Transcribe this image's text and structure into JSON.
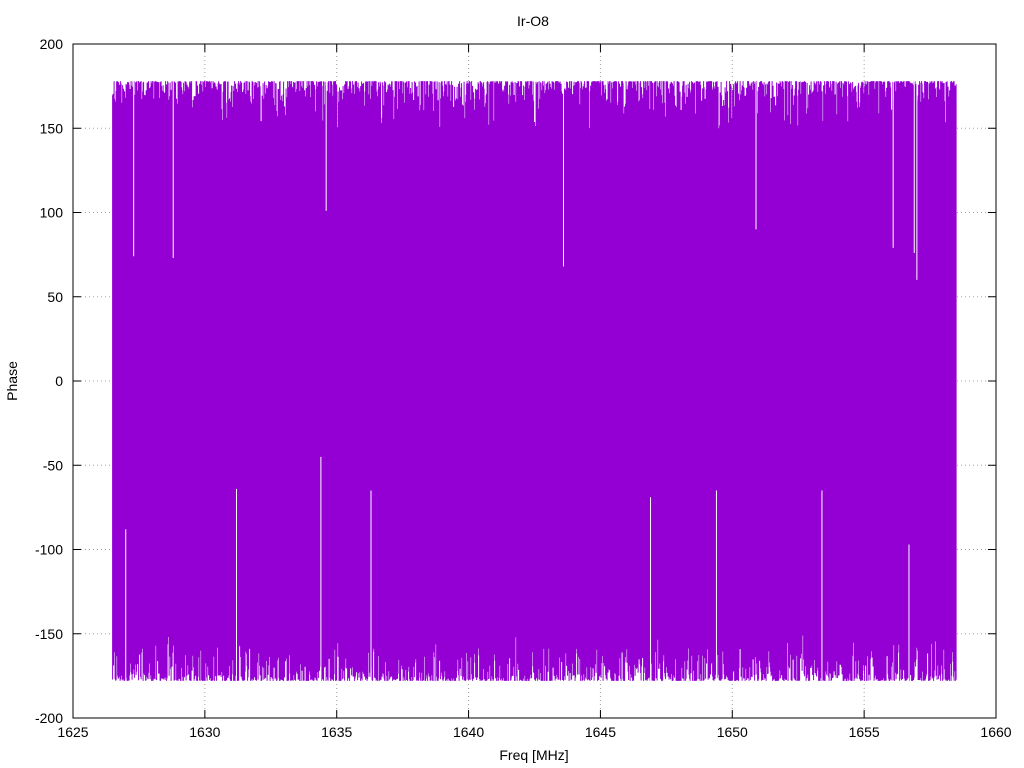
{
  "chart_data": {
    "type": "line",
    "title": "Ir-O8",
    "xlabel": "Freq [MHz]",
    "ylabel": "Phase",
    "xlim": [
      1625,
      1660
    ],
    "ylim": [
      -200,
      200
    ],
    "xticks": [
      "1625",
      "1630",
      "1635",
      "1640",
      "1645",
      "1650",
      "1655",
      "1660"
    ],
    "yticks": [
      "200",
      "150",
      "100",
      "50",
      "0",
      "-50",
      "-100",
      "-150",
      "-200"
    ],
    "grid": true,
    "series_color": "#9400d3",
    "series": [
      {
        "x_range": [
          1626.5,
          1658.5
        ],
        "envelope_upper": 178,
        "envelope_lower": -178,
        "description_values": "phase wraps rapidly between about -180 and 180 across the whole band",
        "notable_upper_dips": [
          [
            1627.3,
            74
          ],
          [
            1628.8,
            73
          ],
          [
            1634.6,
            101
          ],
          [
            1643.6,
            68
          ],
          [
            1650.9,
            90
          ],
          [
            1656.1,
            79
          ],
          [
            1656.9,
            76
          ],
          [
            1657.0,
            60
          ]
        ],
        "notable_lower_spikes": [
          [
            1631.2,
            -64
          ],
          [
            1634.4,
            -45
          ],
          [
            1636.3,
            -65
          ],
          [
            1646.9,
            -69
          ],
          [
            1649.4,
            -65
          ],
          [
            1653.4,
            -65
          ],
          [
            1656.7,
            -97
          ],
          [
            1627.0,
            -88
          ]
        ]
      }
    ]
  }
}
